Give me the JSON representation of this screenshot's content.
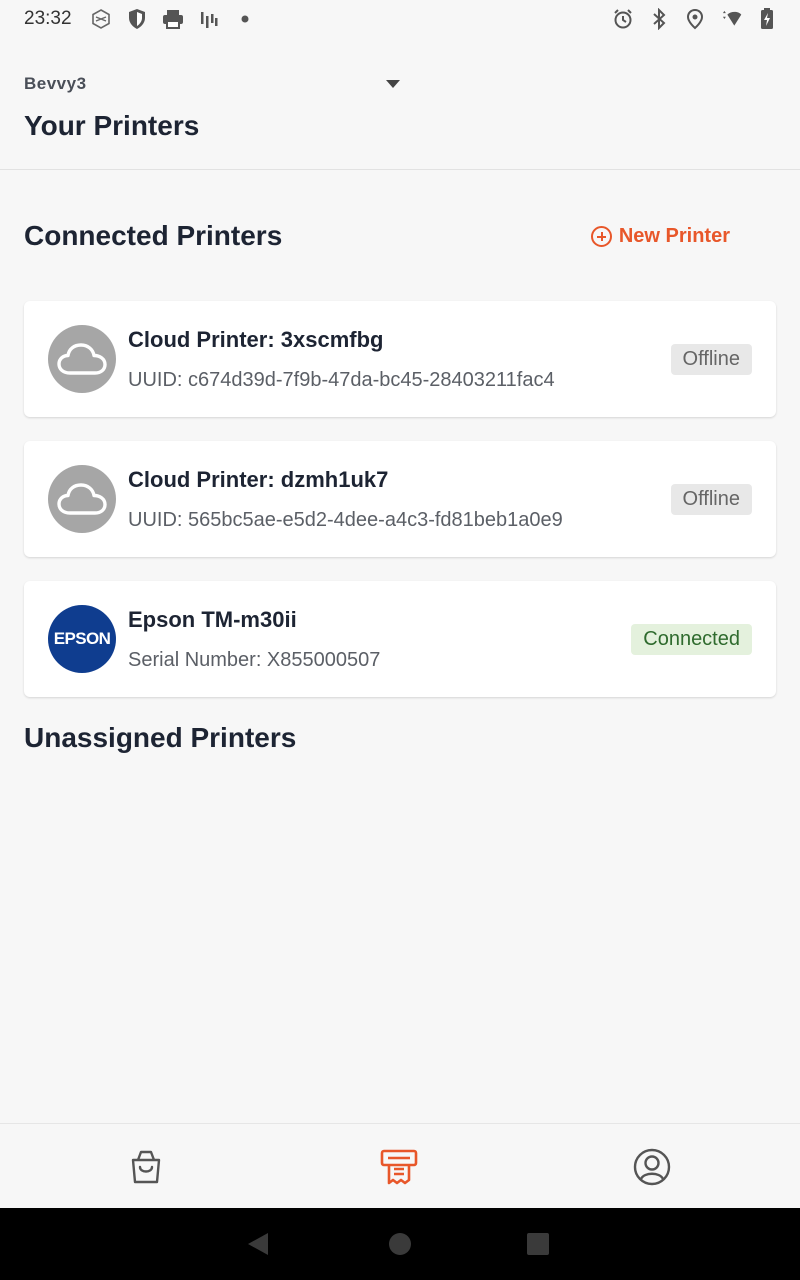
{
  "status_bar": {
    "time": "23:32",
    "left_icons": [
      "app-notification-icon",
      "shield-icon",
      "printer-icon",
      "signal-bars-icon",
      "dot-icon"
    ],
    "right_icons": [
      "alarm-icon",
      "bluetooth-icon",
      "location-icon",
      "wifi-icon",
      "battery-icon"
    ]
  },
  "header": {
    "store_name": "Bevvy3",
    "title": "Your Printers"
  },
  "connected": {
    "title": "Connected Printers",
    "new_printer_label": "New Printer",
    "printers": [
      {
        "name": "Cloud Printer: 3xscmfbg",
        "detail": "UUID: c674d39d-7f9b-47da-bc45-28403211fac4",
        "status": "Offline",
        "icon": "cloud-icon"
      },
      {
        "name": "Cloud Printer: dzmh1uk7",
        "detail": "UUID: 565bc5ae-e5d2-4dee-a4c3-fd81beb1a0e9",
        "status": "Offline",
        "icon": "cloud-icon"
      },
      {
        "name": "Epson TM-m30ii",
        "detail": "Serial Number: X855000507",
        "status": "Connected",
        "logo_text": "EPSON"
      }
    ]
  },
  "unassigned": {
    "title": "Unassigned Printers"
  },
  "bottom_nav": {
    "items": [
      "shopping-bag-icon",
      "receipt-printer-icon",
      "account-icon"
    ],
    "active": "receipt-printer-icon"
  },
  "colors": {
    "accent": "#e8572a",
    "epson_blue": "#0f3d8f",
    "offline_badge_bg": "#e8e8e8",
    "connected_badge_bg": "#e4f1dd",
    "connected_text": "#2f6b2e"
  }
}
